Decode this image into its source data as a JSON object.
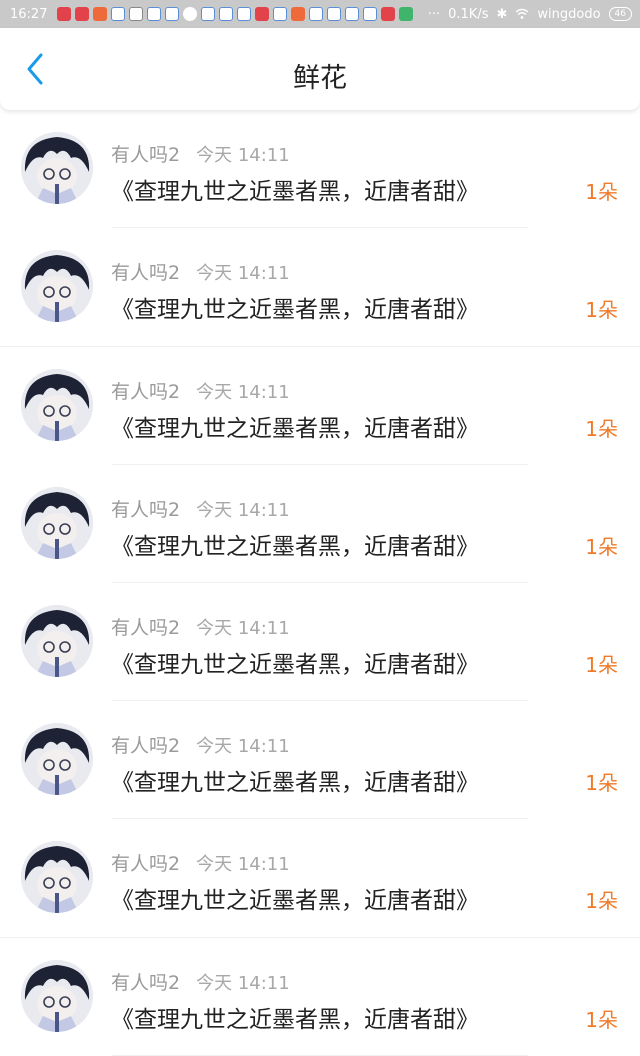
{
  "status_bar": {
    "time": "16:27",
    "network_speed": "0.1K/s",
    "wifi_name": "wingdodo",
    "battery": "46",
    "icons": [
      "app-red",
      "app-red",
      "app-orange",
      "app-blue",
      "app-blue",
      "app-blue",
      "app-blue",
      "weather-cloud",
      "app-blue",
      "app-blue",
      "app-blue",
      "app-red",
      "app-blue",
      "app-orange",
      "app-blue",
      "app-blue",
      "app-blue",
      "app-blue",
      "app-red",
      "app-green"
    ]
  },
  "header": {
    "title": "鲜花",
    "back_icon": "chevron-left-icon",
    "accent_color": "#1a9aea"
  },
  "colors": {
    "count_orange": "#f07a2a"
  },
  "list": {
    "items": [
      {
        "user": "有人吗2",
        "time": "今天 14:11",
        "book": "《查理九世之近墨者黑，近唐者甜》",
        "count": "1朵"
      },
      {
        "user": "有人吗2",
        "time": "今天 14:11",
        "book": "《查理九世之近墨者黑，近唐者甜》",
        "count": "1朵"
      },
      {
        "user": "有人吗2",
        "time": "今天 14:11",
        "book": "《查理九世之近墨者黑，近唐者甜》",
        "count": "1朵"
      },
      {
        "user": "有人吗2",
        "time": "今天 14:11",
        "book": "《查理九世之近墨者黑，近唐者甜》",
        "count": "1朵"
      },
      {
        "user": "有人吗2",
        "time": "今天 14:11",
        "book": "《查理九世之近墨者黑，近唐者甜》",
        "count": "1朵"
      },
      {
        "user": "有人吗2",
        "time": "今天 14:11",
        "book": "《查理九世之近墨者黑，近唐者甜》",
        "count": "1朵"
      },
      {
        "user": "有人吗2",
        "time": "今天 14:11",
        "book": "《查理九世之近墨者黑，近唐者甜》",
        "count": "1朵"
      },
      {
        "user": "有人吗2",
        "time": "今天 14:11",
        "book": "《查理九世之近墨者黑，近唐者甜》",
        "count": "1朵"
      }
    ]
  }
}
